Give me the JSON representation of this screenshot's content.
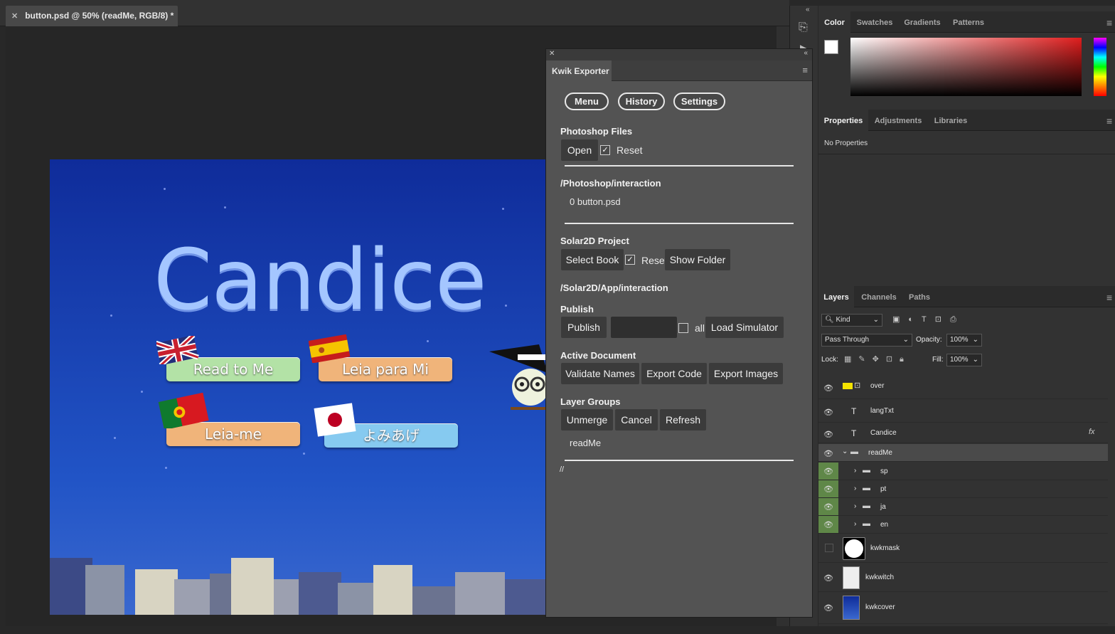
{
  "document": {
    "tab_title": "button.psd @ 50% (readMe, RGB/8) *"
  },
  "canvas": {
    "title": "Candice",
    "buttons": [
      {
        "label": "Read to Me",
        "color": "#b3e2a6"
      },
      {
        "label": "Leia para Mi",
        "color": "#f0b47a"
      },
      {
        "label": "Leia-me",
        "color": "#f0b47a"
      },
      {
        "label": "よみあげ",
        "color": "#86caf0"
      }
    ]
  },
  "kwik": {
    "panel_title": "Kwik Exporter",
    "top_buttons": [
      "Menu",
      "History",
      "Settings"
    ],
    "photoshop_files": {
      "heading": "Photoshop Files",
      "open": "Open",
      "reset": "Reset",
      "reset_checked": true
    },
    "ps_path": "/Photoshop/interaction",
    "ps_file": "0 button.psd",
    "solar": {
      "heading": "Solar2D Project",
      "select": "Select Book",
      "reset": "Reset",
      "reset_checked": true,
      "show_folder": "Show Folder"
    },
    "solar_path": "/Solar2D/App/interaction",
    "publish": {
      "heading": "Publish",
      "button": "Publish",
      "all": "all",
      "all_checked": false,
      "simulator": "Load Simulator"
    },
    "active": {
      "heading": "Active Document",
      "validate": "Validate Names",
      "export_code": "Export Code",
      "export_images": "Export Images"
    },
    "groups": {
      "heading": "Layer Groups",
      "unmerge": "Unmerge",
      "cancel": "Cancel",
      "refresh": "Refresh",
      "current": "readMe"
    },
    "footer": "//"
  },
  "color_panel": {
    "tabs": [
      "Color",
      "Swatches",
      "Gradients",
      "Patterns"
    ]
  },
  "properties_panel": {
    "tabs": [
      "Properties",
      "Adjustments",
      "Libraries"
    ],
    "empty_text": "No Properties"
  },
  "layers_panel": {
    "tabs": [
      "Layers",
      "Channels",
      "Paths"
    ],
    "filter_kind": "Kind",
    "blend_mode": "Pass Through",
    "opacity_label": "Opacity:",
    "opacity": "100%",
    "lock_label": "Lock:",
    "fill_label": "Fill:",
    "fill": "100%",
    "layers": [
      {
        "name": "over",
        "kind": "shape",
        "visible": true
      },
      {
        "name": "langTxt",
        "kind": "text",
        "visible": true
      },
      {
        "name": "Candice",
        "kind": "text",
        "visible": true,
        "fx": "fx"
      },
      {
        "name": "readMe",
        "kind": "group-open",
        "visible": true
      },
      {
        "name": "sp",
        "kind": "group",
        "visible": true
      },
      {
        "name": "pt",
        "kind": "group",
        "visible": true
      },
      {
        "name": "ja",
        "kind": "group",
        "visible": true
      },
      {
        "name": "en",
        "kind": "group",
        "visible": true
      },
      {
        "name": "kwkmask",
        "kind": "image",
        "visible": false
      },
      {
        "name": "kwkwitch",
        "kind": "image",
        "visible": true
      },
      {
        "name": "kwkcover",
        "kind": "image",
        "visible": true
      }
    ]
  }
}
